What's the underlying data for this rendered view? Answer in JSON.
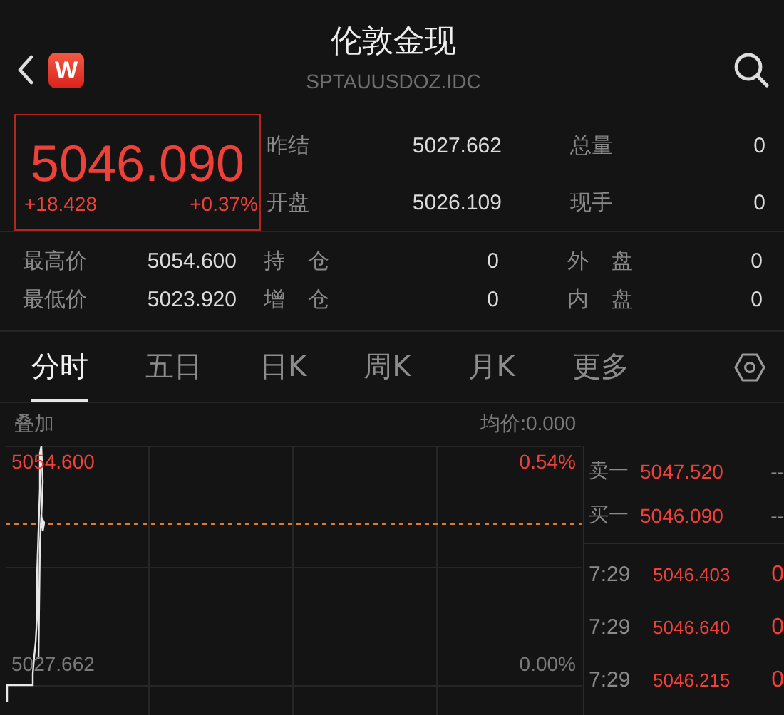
{
  "header": {
    "logo": "W",
    "title": "伦敦金现",
    "subtitle": "SPTAUUSDOZ.IDC"
  },
  "quote": {
    "price": "5046.090",
    "change": "+18.428",
    "change_pct": "+0.37%"
  },
  "stats_top": [
    {
      "label": "昨结",
      "value": "5027.662"
    },
    {
      "label": "总量",
      "value": "0"
    },
    {
      "label": "开盘",
      "value": "5026.109"
    },
    {
      "label": "现手",
      "value": "0"
    }
  ],
  "stats_bottom": [
    {
      "label": "最高价",
      "value": "5054.600"
    },
    {
      "label": "持 仓",
      "value": "0"
    },
    {
      "label": "外 盘",
      "value": "0"
    },
    {
      "label": "最低价",
      "value": "5023.920"
    },
    {
      "label": "增 仓",
      "value": "0"
    },
    {
      "label": "内 盘",
      "value": "0"
    }
  ],
  "tabs": [
    {
      "label": "分时",
      "selected": true
    },
    {
      "label": "五日",
      "selected": false
    },
    {
      "label": "日K",
      "selected": false
    },
    {
      "label": "周K",
      "selected": false
    },
    {
      "label": "月K",
      "selected": false
    },
    {
      "label": "更多",
      "selected": false
    }
  ],
  "chart": {
    "overlay_label": "叠加",
    "avg_label": "均价:0.000",
    "high": "5054.600",
    "high_pct": "0.54%",
    "base": "5027.662",
    "base_pct": "0.00%"
  },
  "order_book": [
    {
      "label": "卖一",
      "price": "5047.520",
      "volume": "--"
    },
    {
      "label": "买一",
      "price": "5046.090",
      "volume": "--"
    }
  ],
  "ticks": [
    {
      "time": "7:29",
      "price": "5046.403",
      "volume": "0"
    },
    {
      "time": "7:29",
      "price": "5046.640",
      "volume": "0"
    },
    {
      "time": "7:29",
      "price": "5046.215",
      "volume": "0"
    }
  ]
}
